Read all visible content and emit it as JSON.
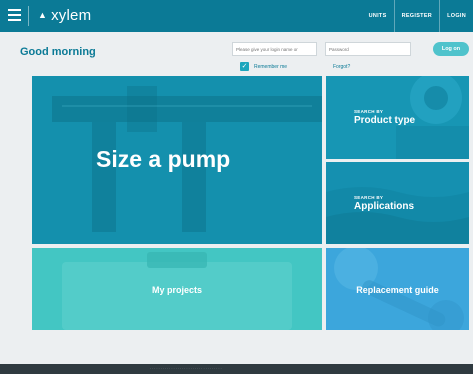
{
  "header": {
    "brand": "xylem",
    "nav": [
      "UNITS",
      "REGISTER",
      "LOGIN"
    ]
  },
  "greeting": "Good morning",
  "login": {
    "username_placeholder": "Please give your login name or",
    "password_placeholder": "Password",
    "button": "Log on",
    "remember_label": "Remember me",
    "forgot_label": "Forgot?"
  },
  "tiles": {
    "size_pump": "Size a pump",
    "product_type": {
      "kicker": "SEARCH BY",
      "title": "Product type"
    },
    "applications": {
      "kicker": "SEARCH BY",
      "title": "Applications"
    },
    "my_projects": "My projects",
    "replacement": "Replacement guide"
  },
  "colors": {
    "header": "#0b7a96",
    "accent": "#4fc3cc",
    "tile_blue": "#1490ad",
    "tile_teal": "#43c6c3",
    "tile_light_blue": "#3ca6dc"
  }
}
